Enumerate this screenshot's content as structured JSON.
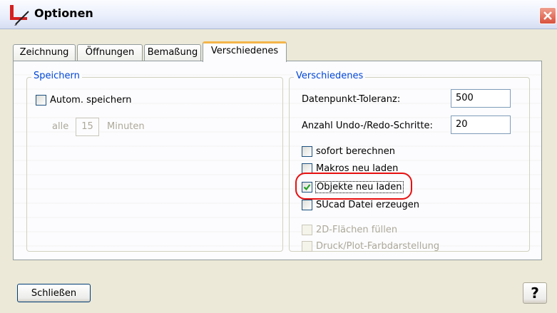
{
  "window": {
    "title": "Optionen"
  },
  "tabs": [
    {
      "label": "Zeichnung"
    },
    {
      "label": "Öffnungen"
    },
    {
      "label": "Bemaßung"
    },
    {
      "label": "Verschiedenes",
      "active": true
    }
  ],
  "speichern": {
    "title": "Speichern",
    "autosave": {
      "label": "Autom. speichern",
      "checked": false
    },
    "interval_prefix": "alle",
    "interval_value": "15",
    "interval_unit": "Minuten"
  },
  "verschiedenes": {
    "title": "Verschiedenes",
    "tolerance_label": "Datenpunkt-Toleranz:",
    "tolerance_value": "500",
    "undo_label": "Anzahl Undo-/Redo-Schritte:",
    "undo_value": "20",
    "options": [
      {
        "label": "sofort berechnen",
        "checked": false,
        "enabled": true
      },
      {
        "label": "Makros neu laden",
        "checked": false,
        "enabled": true
      },
      {
        "label": "Objekte neu laden",
        "checked": true,
        "enabled": true
      },
      {
        "label": "SUcad Datei erzeugen",
        "checked": false,
        "enabled": true
      },
      {
        "label": "2D-Flächen füllen",
        "checked": false,
        "enabled": false
      },
      {
        "label": "Druck/Plot-Farbdarstellung",
        "checked": false,
        "enabled": false
      }
    ]
  },
  "buttons": {
    "close_label": "Schließen",
    "help_label": "?"
  },
  "colors": {
    "group_title": "#0046d5",
    "active_tab_accent": "#f4b44a",
    "highlight": "#e81010"
  }
}
